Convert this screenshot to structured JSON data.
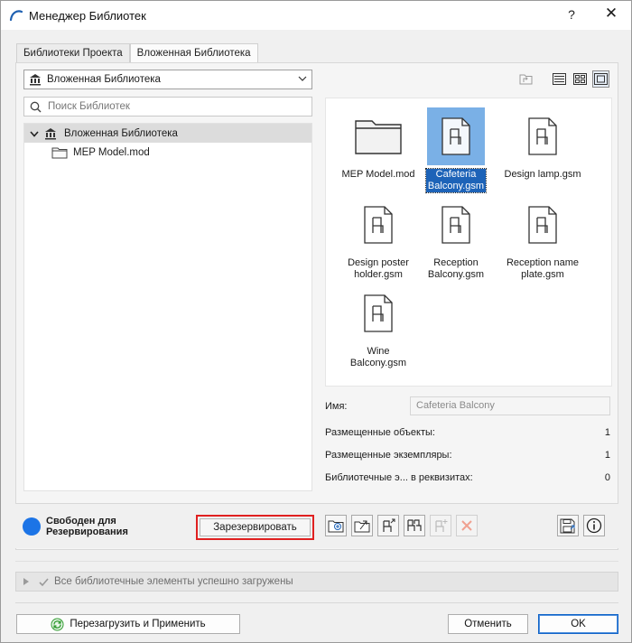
{
  "window": {
    "title": "Менеджер Библиотек",
    "help_label": "?",
    "close_label": "✕"
  },
  "tabs": [
    {
      "label": "Библиотеки Проекта",
      "active": false
    },
    {
      "label": "Вложенная Библиотека",
      "active": true
    }
  ],
  "library_select": {
    "value": "Вложенная Библиотека"
  },
  "search": {
    "placeholder": "Поиск Библиотек",
    "value": ""
  },
  "tree": {
    "root": {
      "label": "Вложенная Библиотека",
      "expanded": true,
      "selected": true
    },
    "children": [
      {
        "label": "MEP Model.mod",
        "icon": "folder-icon"
      }
    ]
  },
  "view_buttons": [
    {
      "name": "up-level-icon",
      "active": false
    },
    {
      "name": "list-view-icon",
      "active": false
    },
    {
      "name": "small-icons-view-icon",
      "active": false
    },
    {
      "name": "large-icons-view-icon",
      "active": true
    }
  ],
  "items": [
    {
      "name_lines": [
        "MEP Model.mod"
      ],
      "icon": "folder-icon",
      "selected": false
    },
    {
      "name_lines": [
        "Cafeteria",
        "Balcony.gsm"
      ],
      "icon": "chair-object-icon",
      "selected": true
    },
    {
      "name_lines": [
        "Design lamp.gsm"
      ],
      "icon": "chair-object-icon",
      "selected": false
    },
    {
      "name_lines": [
        "Design poster",
        "holder.gsm"
      ],
      "icon": "chair-object-icon",
      "selected": false
    },
    {
      "name_lines": [
        "Reception",
        "Balcony.gsm"
      ],
      "icon": "chair-object-icon",
      "selected": false
    },
    {
      "name_lines": [
        "Reception name",
        "plate.gsm"
      ],
      "icon": "chair-object-icon",
      "selected": false
    },
    {
      "name_lines": [
        "Wine",
        "Balcony.gsm"
      ],
      "icon": "chair-object-icon",
      "selected": false
    }
  ],
  "properties": {
    "name_label": "Имя:",
    "name_value": "Cafeteria Balcony",
    "placed_objects_label": "Размещенные объекты:",
    "placed_objects_value": "1",
    "placed_instances_label": "Размещенные экземпляры:",
    "placed_instances_value": "1",
    "library_in_props_label": "Библиотечные э... в реквизитах:",
    "library_in_props_value": "0"
  },
  "status": {
    "line1": "Свободен для",
    "line2": "Резервирования",
    "color": "#1c74e6",
    "reserve_button": "Зарезервировать"
  },
  "notice": {
    "text": "Все библиотечные элементы успешно загружены"
  },
  "footer": {
    "reload_button": "Перезагрузить и Применить",
    "cancel_button": "Отменить",
    "ok_button": "OK"
  }
}
